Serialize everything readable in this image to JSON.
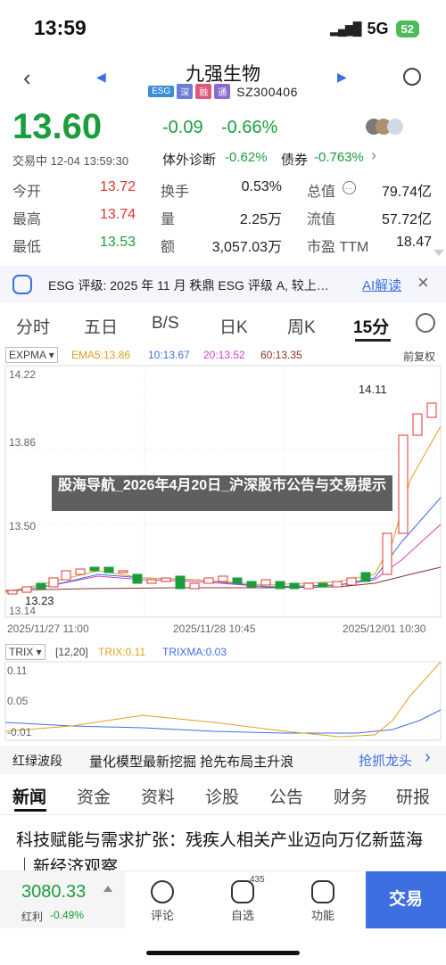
{
  "status": {
    "time": "13:59",
    "network": "5G",
    "battery": "52"
  },
  "header": {
    "title": "九强生物",
    "tags": [
      "ESG",
      "深",
      "融",
      "通"
    ],
    "code": "SZ300406"
  },
  "quote": {
    "price": "13.60",
    "change": "-0.09",
    "change_pct": "-0.66%",
    "time_label": "交易中 12-04 13:59:30",
    "diagnosis_label": "体外诊断",
    "diagnosis_pct": "-0.62%",
    "bond_label": "债券",
    "bond_pct": "-0.763%",
    "stats": [
      {
        "label": "今开",
        "value": "13.72",
        "label2": "换手",
        "value2": "0.53%",
        "label3": "总值",
        "value3": "79.74亿"
      },
      {
        "label": "最高",
        "value": "13.74",
        "label2": "量",
        "value2": "2.25万",
        "label3": "流值",
        "value3": "57.72亿"
      },
      {
        "label": "最低",
        "value": "13.53",
        "label2": "额",
        "value2": "3,057.03万",
        "label3": "市盈 TTM",
        "value3": "18.47"
      }
    ]
  },
  "esg": {
    "text": "ESG 评级: 2025 年 11 月 秩鼎 ESG 评级 A, 较上…",
    "ai_label": "AI解读"
  },
  "tabs": [
    "分时",
    "五日",
    "B/S",
    "日K",
    "周K",
    "15分"
  ],
  "ma_legend": {
    "indicator": "EXPMA",
    "ema5": "EMA5:13.86",
    "ema10": "10:13.67",
    "ema20": "20:13.52",
    "ema60": "60:13.35",
    "adjust": "前复权"
  },
  "chart_axis": {
    "y_top": "14.22",
    "y_mid": "13.86",
    "y_low": "13.50",
    "y_bottom": "13.14",
    "max_label": "14.11",
    "min_label": "13.23",
    "x_labels": [
      "2025/11/27 11:00",
      "2025/11/28 10:45",
      "2025/12/01 10:30"
    ]
  },
  "trix": {
    "name": "TRIX",
    "param": "[12,20]",
    "trix": "TRIX:0.11",
    "trixma": "TRIXMA:0.03",
    "y": [
      "0.11",
      "0.05",
      "-0.01"
    ]
  },
  "promo": {
    "badge": "红绿波段",
    "text": "量化模型最新挖掘 抢先布局主升浪",
    "link": "抢抓龙头"
  },
  "news_tabs": [
    "新闻",
    "资金",
    "资料",
    "诊股",
    "公告",
    "财务",
    "研报"
  ],
  "headline": "科技赋能与需求扩张：残疾人相关产业迈向万亿新蓝海｜新经济观察",
  "watermark": "股海导航_2026年4月20日_沪深股市公告与交易提示",
  "bottom": {
    "index_value": "3080.33",
    "index_name": "红利",
    "index_pct": "-0.49%",
    "comment": "评论",
    "watchlist": "自选",
    "watch_count": "435",
    "feature": "功能",
    "trade": "交易"
  },
  "colors": {
    "up": "#e0342f",
    "down": "#1a9e3c",
    "accent": "#3d6fe0"
  }
}
